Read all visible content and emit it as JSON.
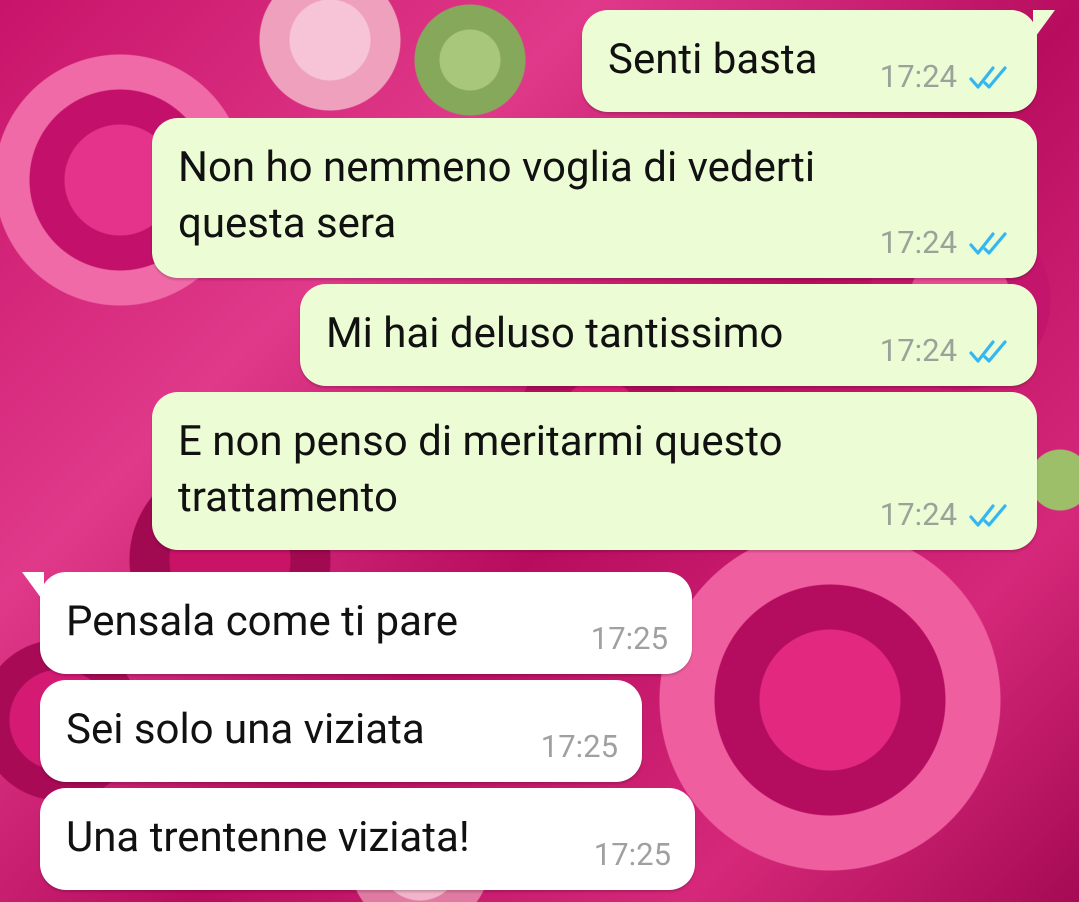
{
  "chat": {
    "outgoing": [
      {
        "lines": [
          "Senti basta"
        ],
        "time": "17:24"
      },
      {
        "lines": [
          "Non ho nemmeno voglia di vederti",
          "questa sera"
        ],
        "time": "17:24"
      },
      {
        "lines": [
          "Mi hai deluso tantissimo"
        ],
        "time": "17:24"
      },
      {
        "lines": [
          "E non penso di meritarmi questo",
          "trattamento"
        ],
        "time": "17:24"
      }
    ],
    "incoming": [
      {
        "lines": [
          "Pensala come ti pare"
        ],
        "time": "17:25"
      },
      {
        "lines": [
          "Sei solo una viziata"
        ],
        "time": "17:25"
      },
      {
        "lines": [
          "Una trentenne viziata!"
        ],
        "time": "17:25"
      }
    ]
  },
  "colors": {
    "outgoing_bubble": "#ecfcd5",
    "incoming_bubble": "#ffffff",
    "read_ticks": "#34b7f1",
    "timestamp": "#9aa39a"
  },
  "icons": {
    "read_status": "double-check-icon",
    "wallpaper": "pink-roses-wallpaper"
  }
}
